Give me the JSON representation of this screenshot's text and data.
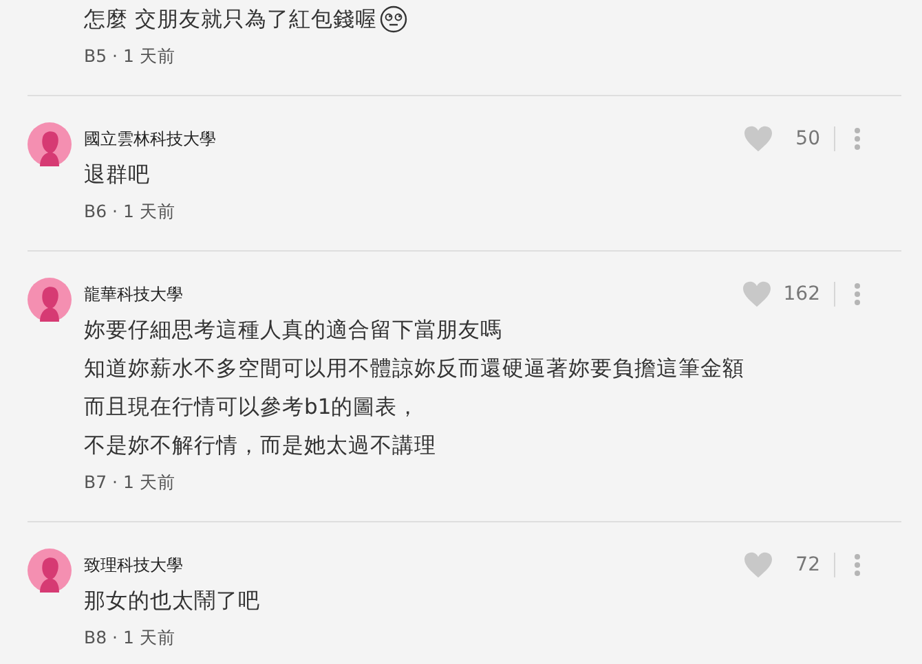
{
  "comments": [
    {
      "lines": [
        "怎麼 交朋友就只為了紅包錢喔"
      ],
      "emoji": true,
      "meta": "B5 · 1 天前"
    },
    {
      "author": "國立雲林科技大學",
      "likes": "50",
      "lines": [
        "退群吧"
      ],
      "emoji": false,
      "meta": "B6 · 1 天前"
    },
    {
      "author": "龍華科技大學",
      "likes": "162",
      "lines": [
        "妳要仔細思考這種人真的適合留下當朋友嗎",
        "知道妳薪水不多空間可以用不體諒妳反而還硬逼著妳要負擔這筆金額",
        "而且現在行情可以參考b1的圖表，",
        "不是妳不解行情，而是她太過不講理"
      ],
      "emoji": false,
      "meta": "B7 · 1 天前"
    },
    {
      "author": "致理科技大學",
      "likes": "72",
      "lines": [
        "那女的也太鬧了吧"
      ],
      "emoji": false,
      "meta": "B8 · 1 天前"
    }
  ]
}
